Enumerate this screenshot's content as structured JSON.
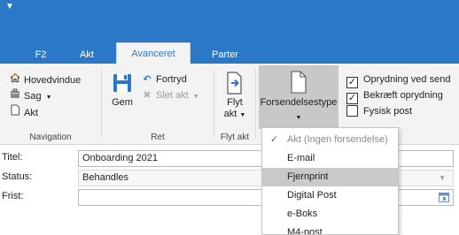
{
  "quick_access": {
    "icon": "customize-quick-access-arrow"
  },
  "tabs": [
    {
      "label": "F2"
    },
    {
      "label": "Akt"
    },
    {
      "label": "Avanceret",
      "active": true
    },
    {
      "label": "Parter"
    }
  ],
  "ribbon": {
    "navigation": {
      "label": "Navigation",
      "items": [
        {
          "label": "Hovedvindue",
          "icon": "home-icon"
        },
        {
          "label": "Sag",
          "icon": "case-icon",
          "has_dropdown": true
        },
        {
          "label": "Akt",
          "icon": "document-icon"
        }
      ]
    },
    "ret": {
      "label": "Ret",
      "save": {
        "label": "Gem",
        "icon": "save-icon"
      },
      "undo": {
        "label": "Fortryd",
        "icon": "undo-icon"
      },
      "delete": {
        "label": "Slet akt",
        "icon": "delete-icon",
        "disabled": true,
        "has_dropdown": true
      }
    },
    "flyt_akt": {
      "label": "Flyt akt",
      "button": {
        "label_line1": "Flyt",
        "label_line2": "akt",
        "icon": "move-document-icon"
      }
    },
    "forsendelse": {
      "button": {
        "label": "Forsendelsestype",
        "icon": "blank-document-icon",
        "active": true
      }
    },
    "options": [
      {
        "label": "Oprydning ved send",
        "checked": true
      },
      {
        "label": "Bekræft oprydning",
        "checked": true
      },
      {
        "label": "Fysisk post",
        "checked": false
      }
    ]
  },
  "form": {
    "title": {
      "label": "Titel:",
      "value": "Onboarding 2021"
    },
    "status": {
      "label": "Status:",
      "value": "Behandles"
    },
    "deadline": {
      "label": "Frist:",
      "value": ""
    }
  },
  "dropdown": {
    "items": [
      {
        "label": "Akt (Ingen forsendelse)",
        "checked": true
      },
      {
        "label": "E-mail"
      },
      {
        "label": "Fjernprint",
        "hovered": true
      },
      {
        "label": "Digital Post"
      },
      {
        "label": "e-Boks"
      },
      {
        "label": "M4-post"
      }
    ]
  },
  "colors": {
    "accent": "#2b78c9",
    "ribbon_bg": "#f3f3f3",
    "hover": "#c9c9c9"
  }
}
